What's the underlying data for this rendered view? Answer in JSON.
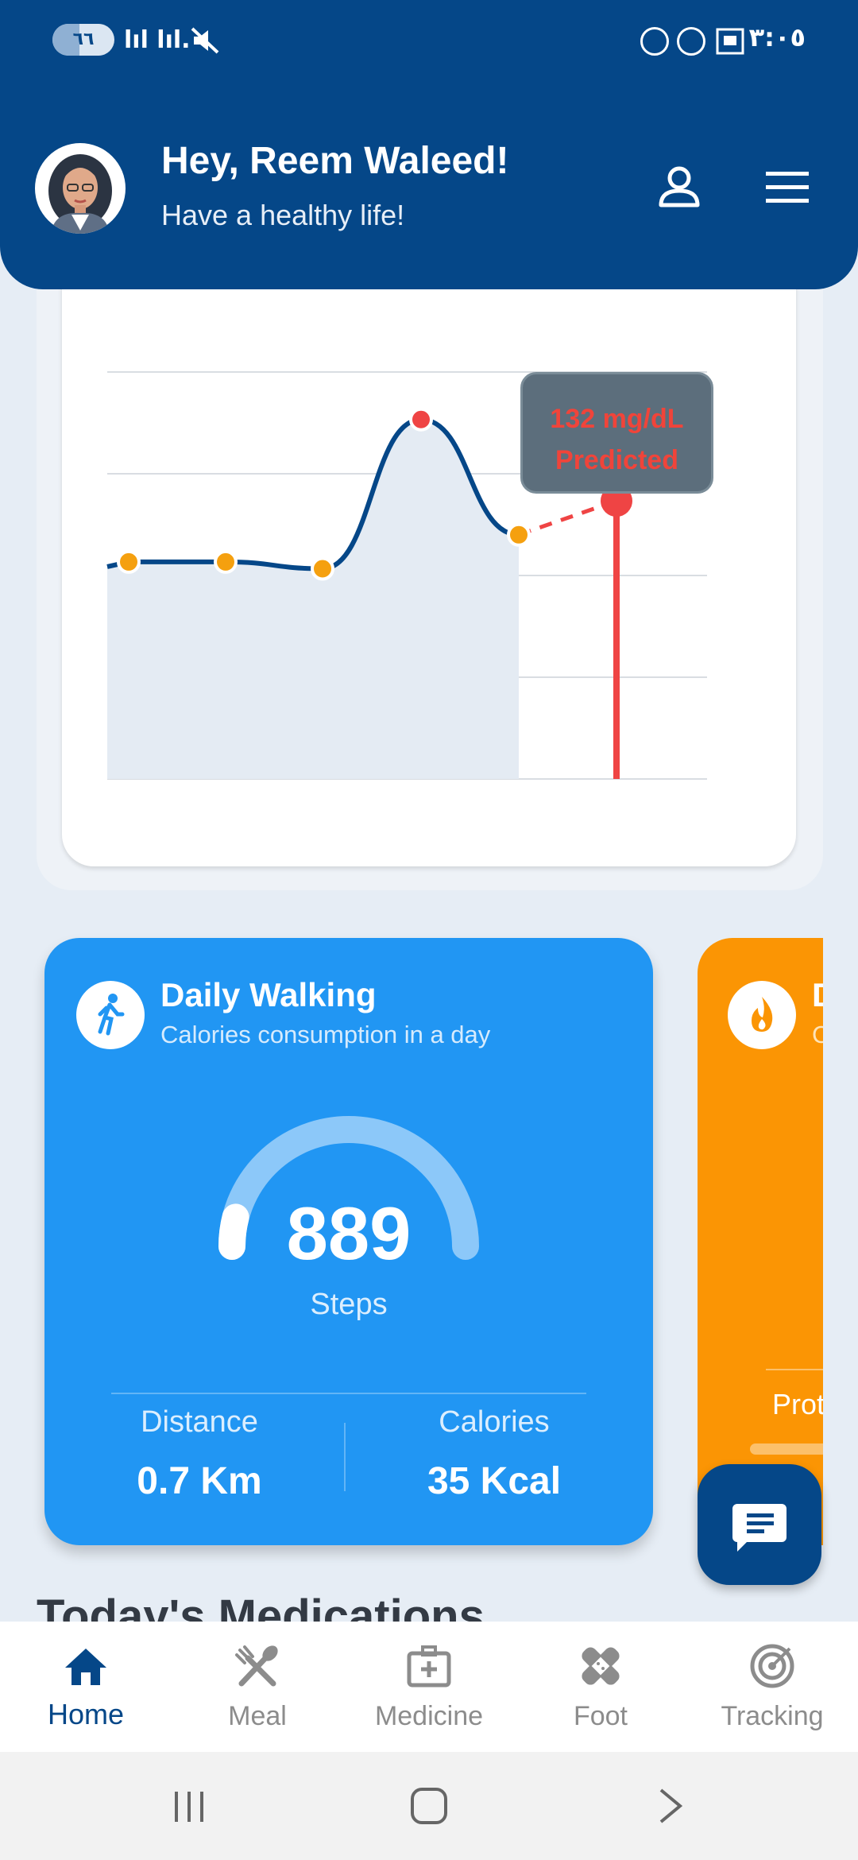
{
  "status_bar": {
    "battery": "٦٦",
    "signal": "lıl͘ lıl.",
    "clock": "٣:٠٥"
  },
  "header": {
    "greeting": "Hey, Reem Waleed!",
    "subtitle": "Have a healthy life!",
    "profile_icon": "person-icon",
    "menu_icon": "hamburger-menu-icon",
    "bg_color": "#054788"
  },
  "glucose_chart": {
    "prediction_label_value": "132 mg/dL",
    "prediction_label_status": "Predicted",
    "chart_data": {
      "type": "line",
      "series": [
        {
          "values": [
            112,
            112,
            111,
            133,
            116
          ]
        },
        {
          "values": [
            116,
            121
          ],
          "style": "dashed"
        }
      ],
      "predicted_value": 132,
      "ylim": [
        80,
        140
      ],
      "grid": true,
      "colors": {
        "line": "#054788",
        "point": "#f5a00f",
        "peak": "#ef4444",
        "predicted": "#ef4444"
      }
    }
  },
  "walking_card": {
    "title": "Daily Walking",
    "subtitle": "Calories consumption in a day",
    "steps_value": "889",
    "steps_label": "Steps",
    "steps_progress": 0.08,
    "distance_label": "Distance",
    "distance_value": "0.7 Km",
    "calories_label": "Calories",
    "calories_value": "35 Kcal",
    "color": "#2196f3"
  },
  "second_card": {
    "title_partial": "D",
    "subtitle_partial": "C",
    "protein_label_partial": "Prot",
    "icon": "flame-icon",
    "color": "#fb9504"
  },
  "chat_fab": {
    "icon": "chat-message-icon"
  },
  "section_title": "Today's Medications",
  "bottom_nav": [
    {
      "label": "Home",
      "icon": "home-icon",
      "active": true
    },
    {
      "label": "Meal",
      "icon": "fork-spoon-icon",
      "active": false
    },
    {
      "label": "Medicine",
      "icon": "medicine-kit-icon",
      "active": false
    },
    {
      "label": "Foot",
      "icon": "bandage-icon",
      "active": false
    },
    {
      "label": "Tracking",
      "icon": "target-icon",
      "active": false
    }
  ]
}
